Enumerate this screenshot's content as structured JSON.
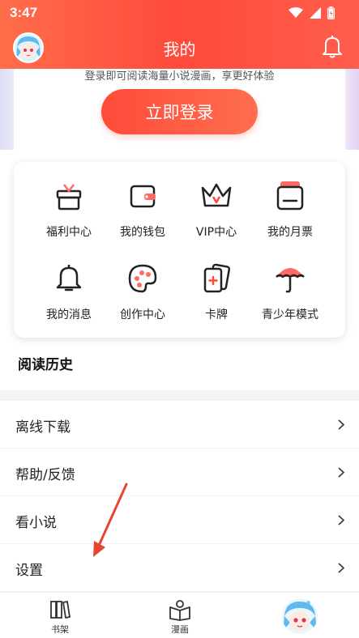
{
  "status_bar": {
    "time": "3:47"
  },
  "header": {
    "title": "我的"
  },
  "login": {
    "tip": "登录即可阅读海量小说漫画，享更好体验",
    "button_label": "立即登录"
  },
  "grid": {
    "items": [
      {
        "label": "福利中心",
        "icon": "gift-icon"
      },
      {
        "label": "我的钱包",
        "icon": "wallet-icon"
      },
      {
        "label": "VIP中心",
        "icon": "crown-icon"
      },
      {
        "label": "我的月票",
        "icon": "ticket-icon"
      },
      {
        "label": "我的消息",
        "icon": "bell-icon"
      },
      {
        "label": "创作中心",
        "icon": "palette-icon"
      },
      {
        "label": "卡牌",
        "icon": "cards-icon"
      },
      {
        "label": "青少年模式",
        "icon": "umbrella-icon"
      }
    ]
  },
  "history": {
    "title": "阅读历史"
  },
  "menu": {
    "items": [
      {
        "label": "离线下载"
      },
      {
        "label": "帮助/反馈"
      },
      {
        "label": "看小说"
      },
      {
        "label": "设置"
      }
    ]
  },
  "tabs": [
    {
      "label": "书架",
      "icon": "bookshelf-icon"
    },
    {
      "label": "漫画",
      "icon": "comic-icon"
    },
    {
      "label": "",
      "icon": "avatar"
    }
  ],
  "colors": {
    "accent": "#ff4a3c",
    "annotation_arrow": "#e8452f"
  }
}
